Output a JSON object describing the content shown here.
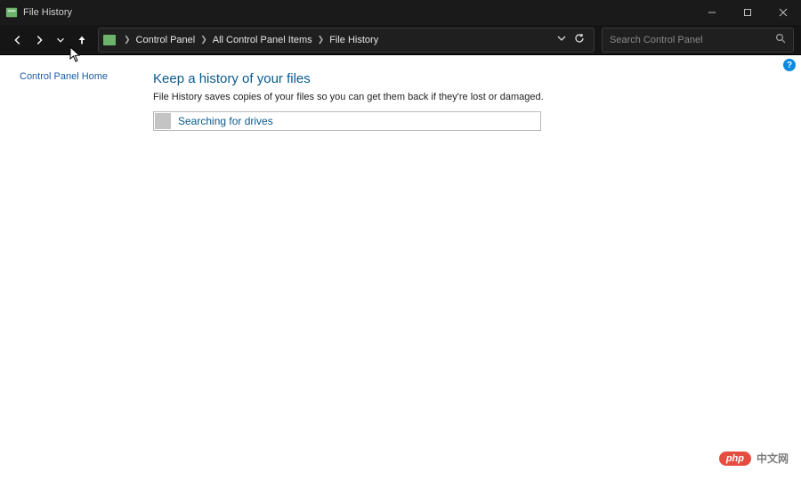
{
  "window": {
    "title": "File History"
  },
  "breadcrumbs": {
    "items": [
      "Control Panel",
      "All Control Panel Items",
      "File History"
    ]
  },
  "search": {
    "placeholder": "Search Control Panel"
  },
  "sidebar": {
    "home_label": "Control Panel Home"
  },
  "main": {
    "heading": "Keep a history of your files",
    "description": "File History saves copies of your files so you can get them back if they're lost or damaged.",
    "status": "Searching for drives"
  },
  "help_badge": "?",
  "watermark": {
    "pill": "php",
    "text": "中文网"
  }
}
